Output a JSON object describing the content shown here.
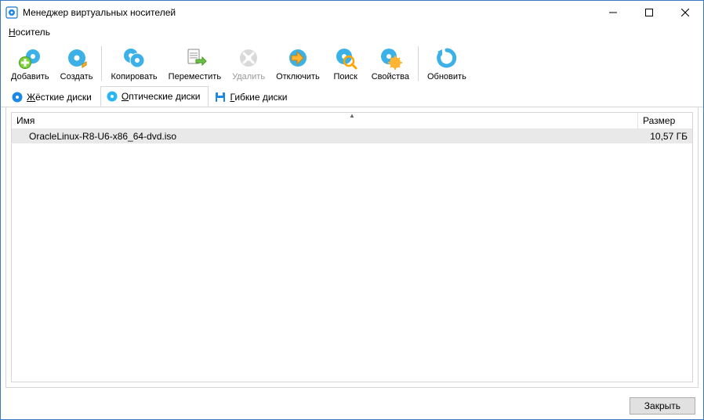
{
  "titlebar": {
    "title": "Менеджер виртуальных носителей"
  },
  "menubar": {
    "medium_prefix": "Н",
    "medium_rest": "оситель"
  },
  "toolbar": {
    "add": "Добавить",
    "create": "Создать",
    "copy": "Копировать",
    "move": "Переместить",
    "remove": "Удалить",
    "release": "Отключить",
    "search": "Поиск",
    "properties": "Свойства",
    "refresh": "Обновить"
  },
  "tabs": {
    "hard": {
      "prefix": "Ж",
      "rest": "ёсткие диски"
    },
    "optical": {
      "prefix": "О",
      "rest": "птические диски"
    },
    "floppy": {
      "prefix": "Г",
      "rest": "ибкие диски"
    }
  },
  "columns": {
    "name": "Имя",
    "size": "Размер"
  },
  "rows": [
    {
      "name": "OracleLinux-R8-U6-x86_64-dvd.iso",
      "size": "10,57 ГБ"
    }
  ],
  "buttons": {
    "close": "Закрыть"
  }
}
